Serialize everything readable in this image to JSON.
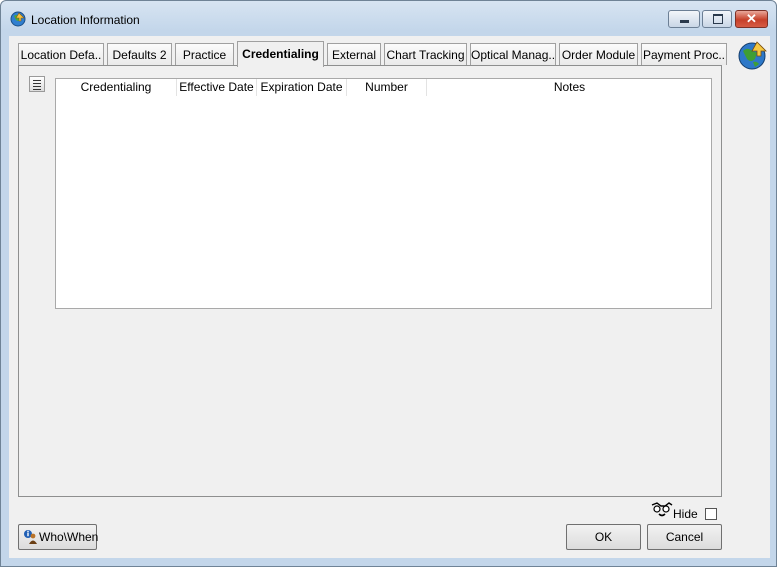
{
  "window": {
    "title": "Location Information",
    "icon": "globe-arrow-icon",
    "controls": [
      "minimize",
      "maximize",
      "close"
    ],
    "close_glyph": "✕"
  },
  "tabs": [
    {
      "label": "Location Defa..",
      "active": false
    },
    {
      "label": "Defaults 2",
      "active": false
    },
    {
      "label": "Practice",
      "active": false
    },
    {
      "label": "Credentialing",
      "active": true
    },
    {
      "label": "External",
      "active": false
    },
    {
      "label": "Chart Tracking",
      "active": false
    },
    {
      "label": "Optical Manag..",
      "active": false
    },
    {
      "label": "Order Module",
      "active": false
    },
    {
      "label": "Payment Proc..",
      "active": false
    }
  ],
  "grid": {
    "columns": [
      "Credentialing",
      "Effective Date",
      "Expiration Date",
      "Number",
      "Notes"
    ],
    "rows": []
  },
  "footer": {
    "hide_label": "Hide",
    "hide_checked": false,
    "whowhen_label": "Who\\When",
    "ok_label": "OK",
    "cancel_label": "Cancel"
  },
  "colors": {
    "frame": "#c3d6ea",
    "client": "#f0f0f0",
    "close_button": "#c7402a"
  }
}
